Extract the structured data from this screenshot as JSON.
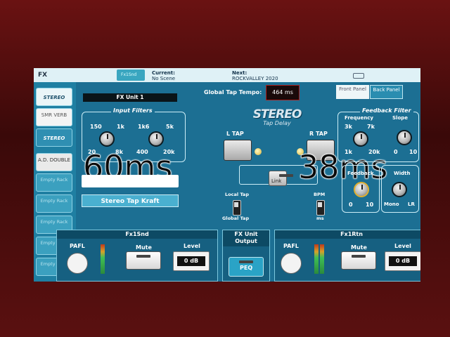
{
  "topbar": {
    "section": "FX",
    "tab": "Fx1Snd",
    "current_label": "Current:",
    "current_value": "No Scene",
    "next_label": "Next:",
    "next_value": "ROCKVALLEY 2020"
  },
  "rack": {
    "slots": [
      {
        "label": "STEREO"
      },
      {
        "label": "SMR VERB"
      },
      {
        "label": "STEREO"
      },
      {
        "label": "A.D. DOUBLE"
      },
      {
        "label": "Empty Rack"
      },
      {
        "label": "Empty Rack"
      },
      {
        "label": "Empty Rack"
      },
      {
        "label": "Empty Rack"
      },
      {
        "label": "Empty Rack"
      }
    ]
  },
  "header": {
    "unit": "FX Unit 1",
    "tap_tempo_label": "Global Tap Tempo:",
    "tap_tempo_value": "464 ms",
    "front_panel": "Front Panel",
    "back_panel": "Back Panel"
  },
  "logo": {
    "main": "STEREO",
    "sub": "Tap Delay"
  },
  "input_filters": {
    "title": "Input Filters",
    "hpf": {
      "top_low": "150",
      "top_high": "1k",
      "bottom_low": "20",
      "bottom_high": "8k"
    },
    "lpf": {
      "top_low": "1k6",
      "top_high": "5k",
      "bottom_low": "400",
      "bottom_high": "20k"
    }
  },
  "taps": {
    "left_label": "L TAP",
    "right_label": "R TAP",
    "left_ms": "60ms",
    "right_ms": "38ms",
    "link_label": "Link",
    "local_tap": "Local Tap",
    "global_tap": "Global Tap",
    "bpm": "BPM",
    "ms": "ms"
  },
  "name_box": "Stereo Tap Kraft",
  "feedback_filter": {
    "title": "Feedback Filter",
    "frequency": "Frequency",
    "slope": "Slope",
    "freq_low_top": "3k",
    "freq_high_top": "7k",
    "freq_low": "1k",
    "freq_high": "20k",
    "slope_low": "0",
    "slope_high": "10"
  },
  "feedback": {
    "label": "Feedback",
    "low": "0",
    "high": "10"
  },
  "width": {
    "label": "Width",
    "low": "Mono",
    "high": "LR"
  },
  "strips": {
    "send": {
      "title": "Fx1Snd",
      "pafl": "PAFL",
      "mute": "Mute",
      "level": "Level",
      "level_value": "0 dB"
    },
    "output": {
      "title": "FX Unit Output",
      "peq": "PEQ"
    },
    "return": {
      "title": "Fx1Rtn",
      "pafl": "PAFL",
      "mute": "Mute",
      "level": "Level",
      "level_value": "0 dB"
    }
  }
}
